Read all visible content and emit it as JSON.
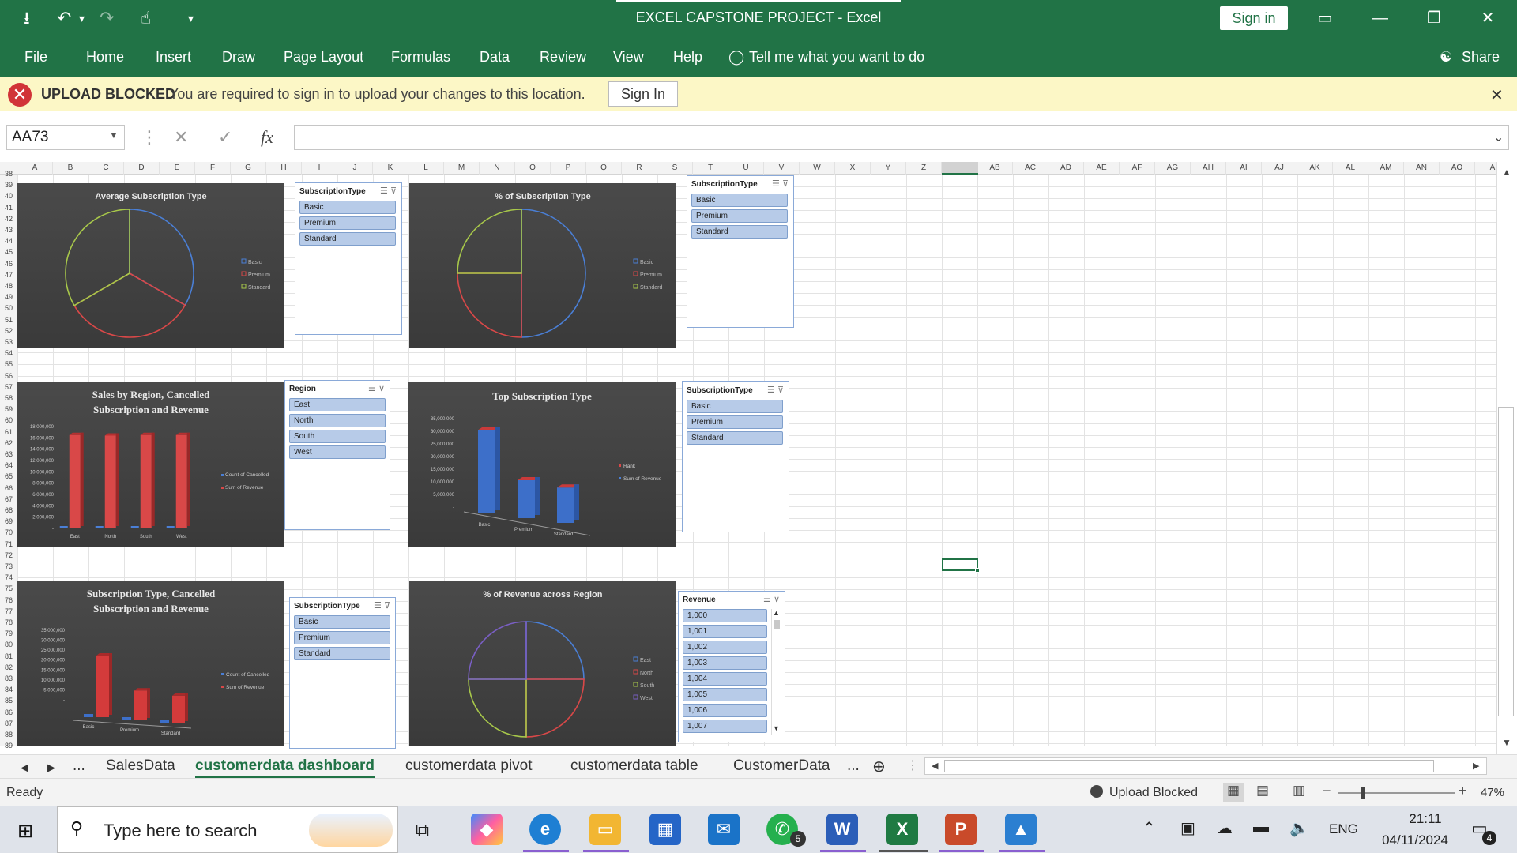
{
  "window": {
    "title": "EXCEL CAPSTONE PROJECT  -  Excel",
    "signin_label": "Sign in",
    "minimize": "—",
    "restore": "❐",
    "close": "✕",
    "ribbon_display": "▭"
  },
  "qat": {
    "save_icon": "⭳",
    "undo_icon": "↶",
    "redo_icon": "↷",
    "touch_icon": "☝",
    "customize_icon": "▾"
  },
  "ribbon": {
    "tabs": [
      "File",
      "Home",
      "Insert",
      "Draw",
      "Page Layout",
      "Formulas",
      "Data",
      "Review",
      "View",
      "Help"
    ],
    "tell_me": "Tell me what you want to do",
    "share": "Share"
  },
  "message_bar": {
    "title": "UPLOAD BLOCKED",
    "text": "You are required to sign in to upload your changes to this location.",
    "button": "Sign In",
    "close": "✕"
  },
  "formula_bar": {
    "name_box": "AA73",
    "cancel_icon": "✕",
    "enter_icon": "✓",
    "fx_icon": "fx",
    "value": ""
  },
  "columns": [
    "A",
    "B",
    "C",
    "D",
    "E",
    "F",
    "G",
    "H",
    "I",
    "J",
    "K",
    "L",
    "M",
    "N",
    "O",
    "P",
    "Q",
    "R",
    "S",
    "T",
    "U",
    "V",
    "W",
    "X",
    "Y",
    "Z",
    "AA",
    "AB",
    "AC",
    "AD",
    "AE",
    "AF",
    "AG",
    "AH",
    "AI",
    "AJ",
    "AK",
    "AL",
    "AM",
    "AN",
    "AO",
    "A"
  ],
  "rows": [
    "38",
    "39",
    "40",
    "41",
    "42",
    "43",
    "44",
    "45",
    "46",
    "47",
    "48",
    "49",
    "50",
    "51",
    "52",
    "53",
    "54",
    "55",
    "56",
    "57",
    "58",
    "59",
    "60",
    "61",
    "62",
    "63",
    "64",
    "65",
    "66",
    "67",
    "68",
    "69",
    "70",
    "71",
    "72",
    "73",
    "74",
    "75",
    "76",
    "77",
    "78",
    "79",
    "80",
    "81",
    "82",
    "83",
    "84",
    "85",
    "86",
    "87",
    "88",
    "89"
  ],
  "charts": {
    "avg_sub_type": {
      "title": "Average Subscription Type",
      "legend": [
        "Basic",
        "Premium",
        "Standard"
      ],
      "colors": [
        "#4a7fd6",
        "#d94848",
        "#a8c84a"
      ]
    },
    "pct_sub_type": {
      "title": "% of Subscription Type",
      "legend": [
        "Basic",
        "Premium",
        "Standard"
      ],
      "colors": [
        "#4a7fd6",
        "#d94848",
        "#a8c84a"
      ]
    },
    "sales_region": {
      "title": "Sales by Region, Cancelled Subscription and Revenue",
      "yticks": [
        "18,000,000",
        "16,000,000",
        "14,000,000",
        "12,000,000",
        "10,000,000",
        "8,000,000",
        "6,000,000",
        "4,000,000",
        "2,000,000",
        "-"
      ],
      "categories": [
        "East",
        "North",
        "South",
        "West"
      ],
      "legend": [
        "Count of Cancelled",
        "Sum of Revenue"
      ],
      "colors": [
        "#4a7fd6",
        "#d94848"
      ]
    },
    "top_sub_type": {
      "title": "Top Subscription Type",
      "yticks": [
        "35,000,000",
        "30,000,000",
        "25,000,000",
        "20,000,000",
        "15,000,000",
        "10,000,000",
        "5,000,000",
        "-"
      ],
      "categories": [
        "Basic",
        "Premium",
        "Standard"
      ],
      "legend": [
        "Rank",
        "Sum of Revenue"
      ],
      "colors": [
        "#d94848",
        "#4a7fd6"
      ]
    },
    "sub_type_cancel": {
      "title": "Subscription Type, Cancelled Subscription and Revenue",
      "yticks": [
        "35,000,000",
        "30,000,000",
        "25,000,000",
        "20,000,000",
        "15,000,000",
        "10,000,000",
        "5,000,000",
        "-"
      ],
      "categories": [
        "Basic",
        "Premium",
        "Standard"
      ],
      "legend": [
        "Count of Cancelled",
        "Sum of Revenue"
      ],
      "colors": [
        "#4a7fd6",
        "#d94848"
      ]
    },
    "pct_rev_region": {
      "title": "% of Revenue across Region",
      "legend": [
        "East",
        "North",
        "South",
        "West"
      ],
      "colors": [
        "#4a7fd6",
        "#d94848",
        "#a8c84a",
        "#7a5fc4"
      ]
    }
  },
  "chart_data": [
    {
      "type": "pie",
      "title": "Average Subscription Type",
      "categories": [
        "Basic",
        "Premium",
        "Standard"
      ],
      "values": [
        33.3,
        33.3,
        33.4
      ]
    },
    {
      "type": "pie",
      "title": "% of Subscription Type",
      "categories": [
        "Basic",
        "Premium",
        "Standard"
      ],
      "values": [
        50,
        25,
        25
      ]
    },
    {
      "type": "bar",
      "title": "Sales by Region, Cancelled Subscription and Revenue",
      "categories": [
        "East",
        "North",
        "South",
        "West"
      ],
      "series": [
        {
          "name": "Count of Cancelled",
          "values": [
            0,
            0,
            0,
            0
          ]
        },
        {
          "name": "Sum of Revenue",
          "values": [
            16500000,
            16400000,
            16500000,
            16500000
          ]
        }
      ],
      "ylim": [
        0,
        18000000
      ]
    },
    {
      "type": "bar",
      "title": "Top Subscription Type",
      "categories": [
        "Basic",
        "Premium",
        "Standard"
      ],
      "series": [
        {
          "name": "Rank",
          "values": [
            0,
            0,
            0
          ]
        },
        {
          "name": "Sum of Revenue",
          "values": [
            33000000,
            15000000,
            14000000
          ]
        }
      ],
      "ylim": [
        0,
        35000000
      ]
    },
    {
      "type": "bar",
      "title": "Subscription Type, Cancelled Subscription and Revenue",
      "categories": [
        "Basic",
        "Premium",
        "Standard"
      ],
      "series": [
        {
          "name": "Count of Cancelled",
          "values": [
            0,
            0,
            0
          ]
        },
        {
          "name": "Sum of Revenue",
          "values": [
            31000000,
            15000000,
            14000000
          ]
        }
      ],
      "ylim": [
        0,
        35000000
      ]
    },
    {
      "type": "pie",
      "title": "% of Revenue across Region",
      "categories": [
        "East",
        "North",
        "South",
        "West"
      ],
      "values": [
        25,
        25,
        25,
        25
      ]
    }
  ],
  "slicers": {
    "s1": {
      "title": "SubscriptionType",
      "items": [
        "Basic",
        "Premium",
        "Standard"
      ]
    },
    "s2": {
      "title": "SubscriptionType",
      "items": [
        "Basic",
        "Premium",
        "Standard"
      ]
    },
    "s3": {
      "title": "Region",
      "items": [
        "East",
        "North",
        "South",
        "West"
      ]
    },
    "s4": {
      "title": "SubscriptionType",
      "items": [
        "Basic",
        "Premium",
        "Standard"
      ]
    },
    "s5": {
      "title": "SubscriptionType",
      "items": [
        "Basic",
        "Premium",
        "Standard"
      ]
    },
    "s6": {
      "title": "Revenue",
      "items": [
        "1,000",
        "1,001",
        "1,002",
        "1,003",
        "1,004",
        "1,005",
        "1,006",
        "1,007"
      ]
    }
  },
  "sheet_tabs": {
    "ellipsis": "...",
    "tabs": [
      "SalesData",
      "customerdata dashboard",
      "customerdata pivot",
      "customerdata table",
      "CustomerData"
    ],
    "active": "customerdata dashboard",
    "more": "..."
  },
  "status_bar": {
    "ready": "Ready",
    "upload_blocked": "Upload Blocked",
    "zoom": "47%"
  },
  "taskbar": {
    "search_placeholder": "Type here to search",
    "time": "21:11",
    "date": "04/11/2024",
    "lang": "ENG",
    "notifications": "4",
    "whatsapp_badge": "5"
  }
}
